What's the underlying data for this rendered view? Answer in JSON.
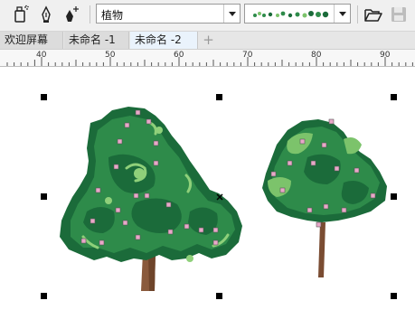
{
  "toolbar": {
    "tools": [
      {
        "name": "spray-bottle-icon"
      },
      {
        "name": "pen-nib-icon"
      },
      {
        "name": "pen-nib-plus-icon"
      }
    ],
    "category_select": {
      "value": "植物"
    },
    "stroke_preview": {
      "name": "hedge-stroke-preview"
    },
    "open_icon": "folder-open-icon",
    "save_icon": "floppy-disk-icon"
  },
  "tabs": {
    "items": [
      {
        "label": "欢迎屏幕",
        "active": false
      },
      {
        "label": "未命名 -1",
        "active": false
      },
      {
        "label": "未命名 -2",
        "active": true
      }
    ],
    "add_label": "+"
  },
  "ruler": {
    "labels": [
      "40",
      "50",
      "60",
      "70",
      "80",
      "90"
    ]
  },
  "colors": {
    "foliage_dark": "#1b6b3a",
    "foliage_mid": "#2e8b4a",
    "foliage_light": "#7cc36b",
    "trunk": "#8a5a3c",
    "toolbar_bg": "#f0f0f0",
    "tab_active": "#eaf3fc"
  }
}
